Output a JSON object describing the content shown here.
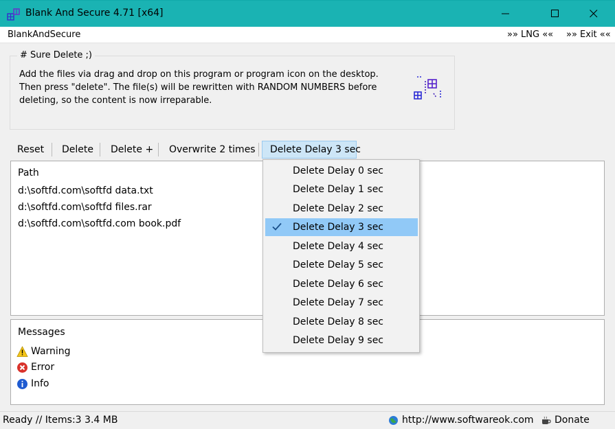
{
  "window": {
    "title": "Blank And Secure 4.71 [x64]",
    "accent": "#1ab3b3"
  },
  "menubar": {
    "app_name": "BlankAndSecure",
    "lng": "»» LNG ««",
    "exit": "»» Exit ««"
  },
  "groupbox": {
    "legend": "# Sure Delete ;)",
    "lines": [
      "Add the files via drag and drop on this program or program icon on the desktop.",
      "Then press \"delete\". The file(s) will be rewritten with RANDOM NUMBERS before",
      "deleting, so the content is now irreparable."
    ]
  },
  "toolbar": {
    "reset": "Reset",
    "delete": "Delete",
    "delete_plus": "Delete +",
    "overwrite": "Overwrite 2 times",
    "delay": "Delete Delay 3 sec"
  },
  "files": {
    "header": "Path",
    "rows": [
      "d:\\softfd.com\\softfd data.txt",
      "d:\\softfd.com\\softfd files.rar",
      "d:\\softfd.com\\softfd.com book.pdf"
    ]
  },
  "messages": {
    "header": "Messages",
    "items": [
      {
        "label": "Warning",
        "icon": "warning-icon"
      },
      {
        "label": "Error",
        "icon": "error-icon"
      },
      {
        "label": "Info",
        "icon": "info-icon"
      }
    ]
  },
  "dropdown": {
    "selected_index": 3,
    "options": [
      "Delete Delay 0 sec",
      "Delete Delay 1 sec",
      "Delete Delay 2 sec",
      "Delete Delay 3 sec",
      "Delete Delay 4 sec",
      "Delete Delay 5 sec",
      "Delete Delay 6 sec",
      "Delete Delay 7 sec",
      "Delete Delay 8 sec",
      "Delete Delay 9 sec"
    ]
  },
  "statusbar": {
    "status": "Ready // Items:3 3.4 MB",
    "url": "http://www.softwareok.com",
    "donate": "Donate"
  }
}
